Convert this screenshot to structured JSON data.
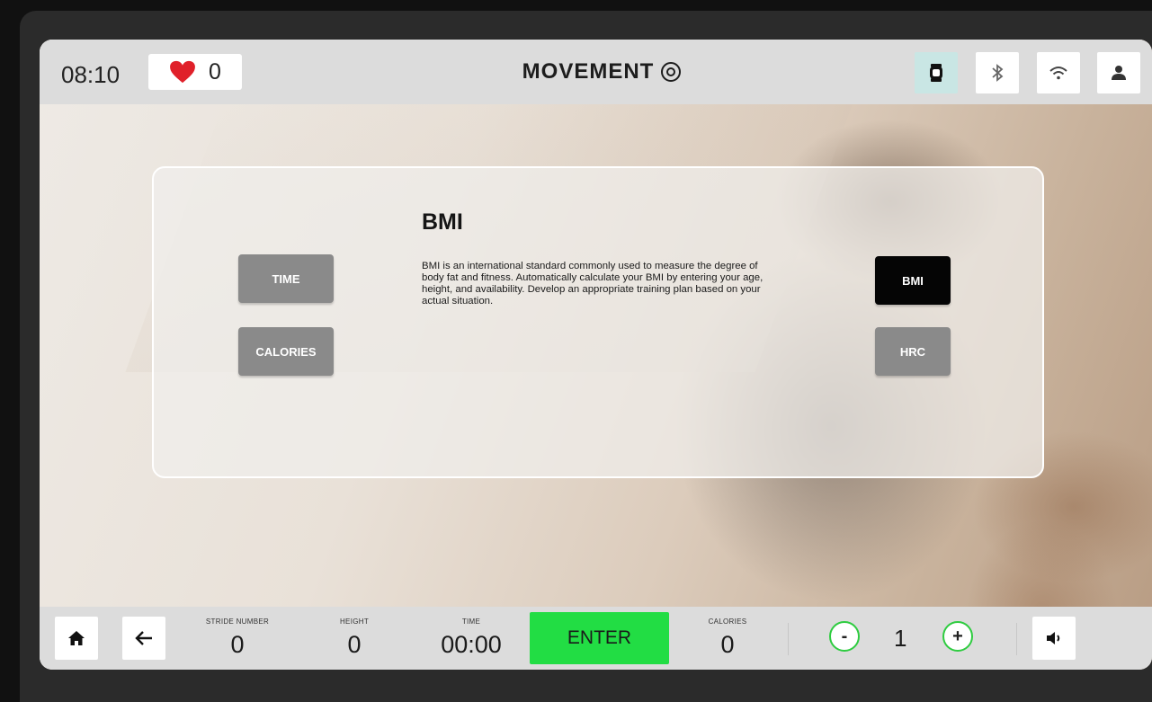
{
  "status_bar": {
    "time": "08:10",
    "heart_rate": "0",
    "brand": "MOVEMENT",
    "icons": [
      "watch-icon",
      "bluetooth-icon",
      "wifi-icon",
      "user-icon"
    ]
  },
  "panel": {
    "title": "BMI",
    "description": "BMI is an international standard commonly used to measure the degree of body fat and fitness. Automatically calculate your BMI by entering your age, height, and availability. Develop an appropriate training plan based on your actual situation.",
    "left_buttons": [
      "TIME",
      "CALORIES"
    ],
    "right_buttons": [
      "BMI",
      "HRC"
    ],
    "active_mode": "BMI"
  },
  "bottom_bar": {
    "stride_label": "STRIDE NUMBER",
    "stride_value": "0",
    "height_label": "HEIGHT",
    "height_value": "0",
    "time_label": "TIME",
    "time_value": "00:00",
    "enter_label": "ENTER",
    "calories_label": "CALORIES",
    "calories_value": "0",
    "minus_label": "-",
    "level_value": "1",
    "plus_label": "+"
  },
  "colors": {
    "accent_green": "#22dd44",
    "heart_red": "#e0202a",
    "active_button": "#050505",
    "inactive_button": "#8a8a8a"
  }
}
